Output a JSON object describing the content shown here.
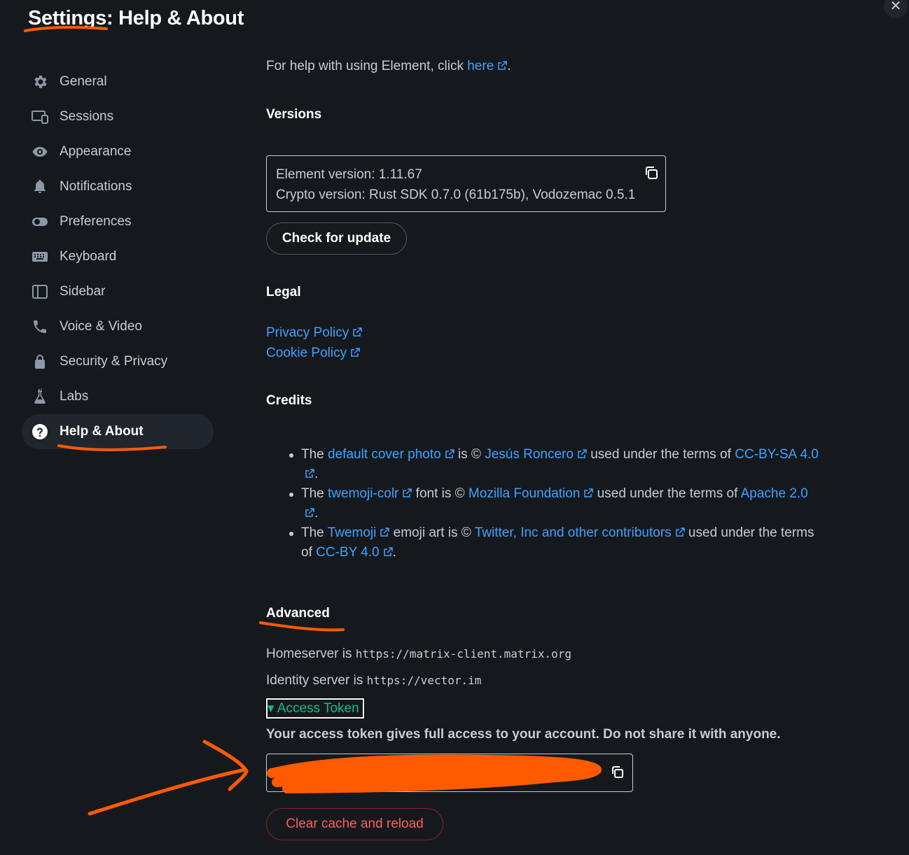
{
  "title": "Settings: Help & About",
  "close_label": "✕",
  "sidebar": {
    "items": [
      {
        "label": "General",
        "icon": "gear-icon"
      },
      {
        "label": "Sessions",
        "icon": "devices-icon"
      },
      {
        "label": "Appearance",
        "icon": "eye-icon"
      },
      {
        "label": "Notifications",
        "icon": "bell-icon"
      },
      {
        "label": "Preferences",
        "icon": "toggle-icon"
      },
      {
        "label": "Keyboard",
        "icon": "keyboard-icon"
      },
      {
        "label": "Sidebar",
        "icon": "sidebar-icon"
      },
      {
        "label": "Voice & Video",
        "icon": "phone-icon"
      },
      {
        "label": "Security & Privacy",
        "icon": "lock-icon"
      },
      {
        "label": "Labs",
        "icon": "flask-icon"
      },
      {
        "label": "Help & About",
        "icon": "help-circle-icon",
        "active": true
      }
    ]
  },
  "help": {
    "prefix": "For help with using Element, click ",
    "link": "here",
    "suffix": "."
  },
  "versions": {
    "heading": "Versions",
    "element_version": "Element version: 1.11.67",
    "crypto_version": "Crypto version: Rust SDK 0.7.0 (61b175b), Vodozemac 0.5.1",
    "check_button": "Check for update"
  },
  "legal": {
    "heading": "Legal",
    "privacy": "Privacy Policy",
    "cookie": "Cookie Policy"
  },
  "credits": {
    "heading": "Credits",
    "items": [
      {
        "t1": "The ",
        "l1": "default cover photo",
        "t2": " is © ",
        "l2": "Jesús Roncero",
        "t3": " used under the terms of ",
        "l3": "CC-BY-SA 4.0",
        "t4": "."
      },
      {
        "t1": "The ",
        "l1": "twemoji-colr",
        "t2": " font is © ",
        "l2": "Mozilla Foundation",
        "t3": " used under the terms of ",
        "l3": "Apache 2.0",
        "t4": "."
      },
      {
        "t1": "The ",
        "l1": "Twemoji",
        "t2": " emoji art is © ",
        "l2": "Twitter, Inc and other contributors",
        "t3": " used under the terms of ",
        "l3": "CC-BY 4.0",
        "t4": "."
      }
    ]
  },
  "advanced": {
    "heading": "Advanced",
    "homeserver_label": "Homeserver is ",
    "homeserver_url": "https://matrix-client.matrix.org",
    "identity_label": "Identity server is ",
    "identity_url": "https://vector.im",
    "token_summary": "▾ Access Token",
    "token_warning": "Your access token gives full access to your account. Do not share it with anyone.",
    "clear_button": "Clear cache and reload"
  },
  "colors": {
    "background": "#15191e",
    "link": "#3ea1ff",
    "annotation": "#ff5a00",
    "danger": "#ff5b55",
    "accent_green": "#0dbd8b"
  }
}
